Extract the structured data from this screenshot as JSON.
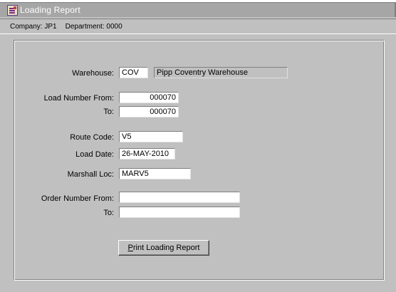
{
  "window": {
    "title": "Loading Report",
    "icon": "report-app-icon"
  },
  "infobar": {
    "company": "Company:  JP1",
    "department": "Department:  0000"
  },
  "form": {
    "warehouse": {
      "label": "Warehouse:",
      "code": "COV",
      "description": "Pipp Coventry Warehouse"
    },
    "load_number_from": {
      "label": "Load Number From:",
      "value": "000070"
    },
    "load_number_to": {
      "label": "To:",
      "value": "000070"
    },
    "route_code": {
      "label": "Route Code:",
      "value": "V5"
    },
    "load_date": {
      "label": "Load Date:",
      "value": "26-MAY-2010"
    },
    "marshall_loc": {
      "label": "Marshall Loc:",
      "value": "MARV5"
    },
    "order_number_from": {
      "label": "Order Number From:",
      "value": ""
    },
    "order_number_to": {
      "label": "To:",
      "value": ""
    }
  },
  "actions": {
    "print_label_first": "P",
    "print_label_rest": "rint Loading Report"
  }
}
